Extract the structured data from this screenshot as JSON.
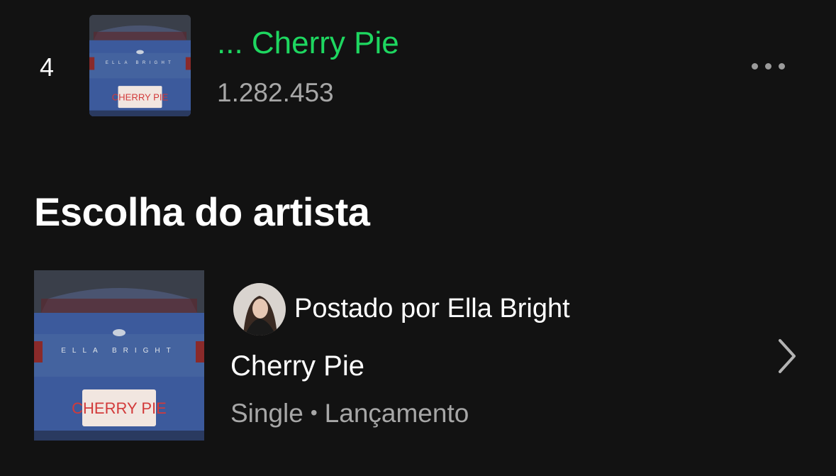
{
  "track": {
    "rank": "4",
    "title": "... Cherry Pie",
    "plays": "1.282.453",
    "cover_icon": "album-cover-car-icon"
  },
  "section": {
    "title": "Escolha do artista"
  },
  "artist_pick": {
    "posted_by": "Postado por Ella Bright",
    "title": "Cherry Pie",
    "type": "Single",
    "separator": "•",
    "status": "Lançamento",
    "cover_text": {
      "band_text": "ELLA BRIGHT",
      "plate_text": "CHERRY PIE"
    }
  },
  "colors": {
    "background": "#121212",
    "accent_green": "#1ed760",
    "text_primary": "#ffffff",
    "text_secondary": "#a7a7a7",
    "car_blue": "#3c5a9c",
    "plate_red": "#d23a3a"
  }
}
